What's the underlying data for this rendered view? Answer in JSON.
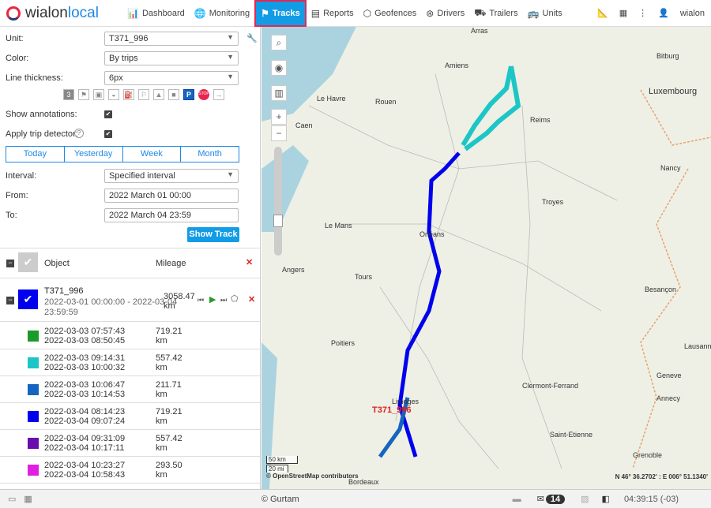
{
  "header": {
    "logo": "wialon local",
    "nav": [
      {
        "label": "Dashboard",
        "icon": "bar-chart-icon"
      },
      {
        "label": "Monitoring",
        "icon": "globe-icon"
      },
      {
        "label": "Tracks",
        "icon": "flag-icon",
        "active": true
      },
      {
        "label": "Reports",
        "icon": "report-icon"
      },
      {
        "label": "Geofences",
        "icon": "geofence-icon"
      },
      {
        "label": "Drivers",
        "icon": "wheel-icon"
      },
      {
        "label": "Trailers",
        "icon": "trailer-icon"
      },
      {
        "label": "Units",
        "icon": "bus-icon"
      }
    ],
    "user": "wialon"
  },
  "form": {
    "unit_label": "Unit:",
    "unit": "T371_996",
    "color_label": "Color:",
    "color": "By trips",
    "thickness_label": "Line thickness:",
    "thickness": "6px",
    "show_annotations_label": "Show annotations:",
    "trip_detector_label": "Apply trip detector:",
    "tabs": [
      "Today",
      "Yesterday",
      "Week",
      "Month"
    ],
    "interval_label": "Interval:",
    "interval": "Specified interval",
    "from_label": "From:",
    "from": "2022 March 01 00:00",
    "to_label": "To:",
    "to": "2022 March 04 23:59",
    "show_track": "Show Track"
  },
  "list": {
    "object_header": "Object",
    "mileage_header": "Mileage",
    "unit": {
      "name": "T371_996",
      "range1": "2022-03-01 00:00:00 - 2022-03-04",
      "range2": "23:59:59",
      "mileage": "3058.47",
      "unit": "km"
    },
    "trips": [
      {
        "start": "2022-03-03 07:57:43",
        "end": "2022-03-03 08:50:45",
        "mileage": "719.21",
        "unit": "km",
        "color": "#1a9a2a"
      },
      {
        "start": "2022-03-03 09:14:31",
        "end": "2022-03-03 10:00:32",
        "mileage": "557.42",
        "unit": "km",
        "color": "#1cc6c6"
      },
      {
        "start": "2022-03-03 10:06:47",
        "end": "2022-03-03 10:14:53",
        "mileage": "211.71",
        "unit": "km",
        "color": "#1565c0"
      },
      {
        "start": "2022-03-04 08:14:23",
        "end": "2022-03-04 09:07:24",
        "mileage": "719.21",
        "unit": "km",
        "color": "#0000ee"
      },
      {
        "start": "2022-03-04 09:31:09",
        "end": "2022-03-04 10:17:11",
        "mileage": "557.42",
        "unit": "km",
        "color": "#6a0dad"
      },
      {
        "start": "2022-03-04 10:23:27",
        "end": "2022-03-04 10:58:43",
        "mileage": "293.50",
        "unit": "km",
        "color": "#e020e0"
      }
    ]
  },
  "map": {
    "cities": [
      "Arras",
      "Amiens",
      "Bitburg",
      "Luxembourg",
      "Le Havre",
      "Rouen",
      "Reims",
      "Caen",
      "Nancy",
      "Troyes",
      "Le Mans",
      "Orléans",
      "Angers",
      "Tours",
      "Besançon",
      "Poitiers",
      "Limoges",
      "Clermont-Ferrand",
      "Lausanne",
      "Geneve",
      "Annecy",
      "Saint-Etienne",
      "Grenoble",
      "Bordeaux"
    ],
    "unit_label": "T371_996",
    "scale_km": "50 km",
    "scale_mi": "20 mi",
    "attribution": "© OpenStreetMap contributors",
    "coords": "N 46° 36.2702' : E 006° 51.1340'"
  },
  "footer": {
    "copyright": "© Gurtam",
    "messages": "14",
    "time": "04:39:15 (-03)"
  }
}
